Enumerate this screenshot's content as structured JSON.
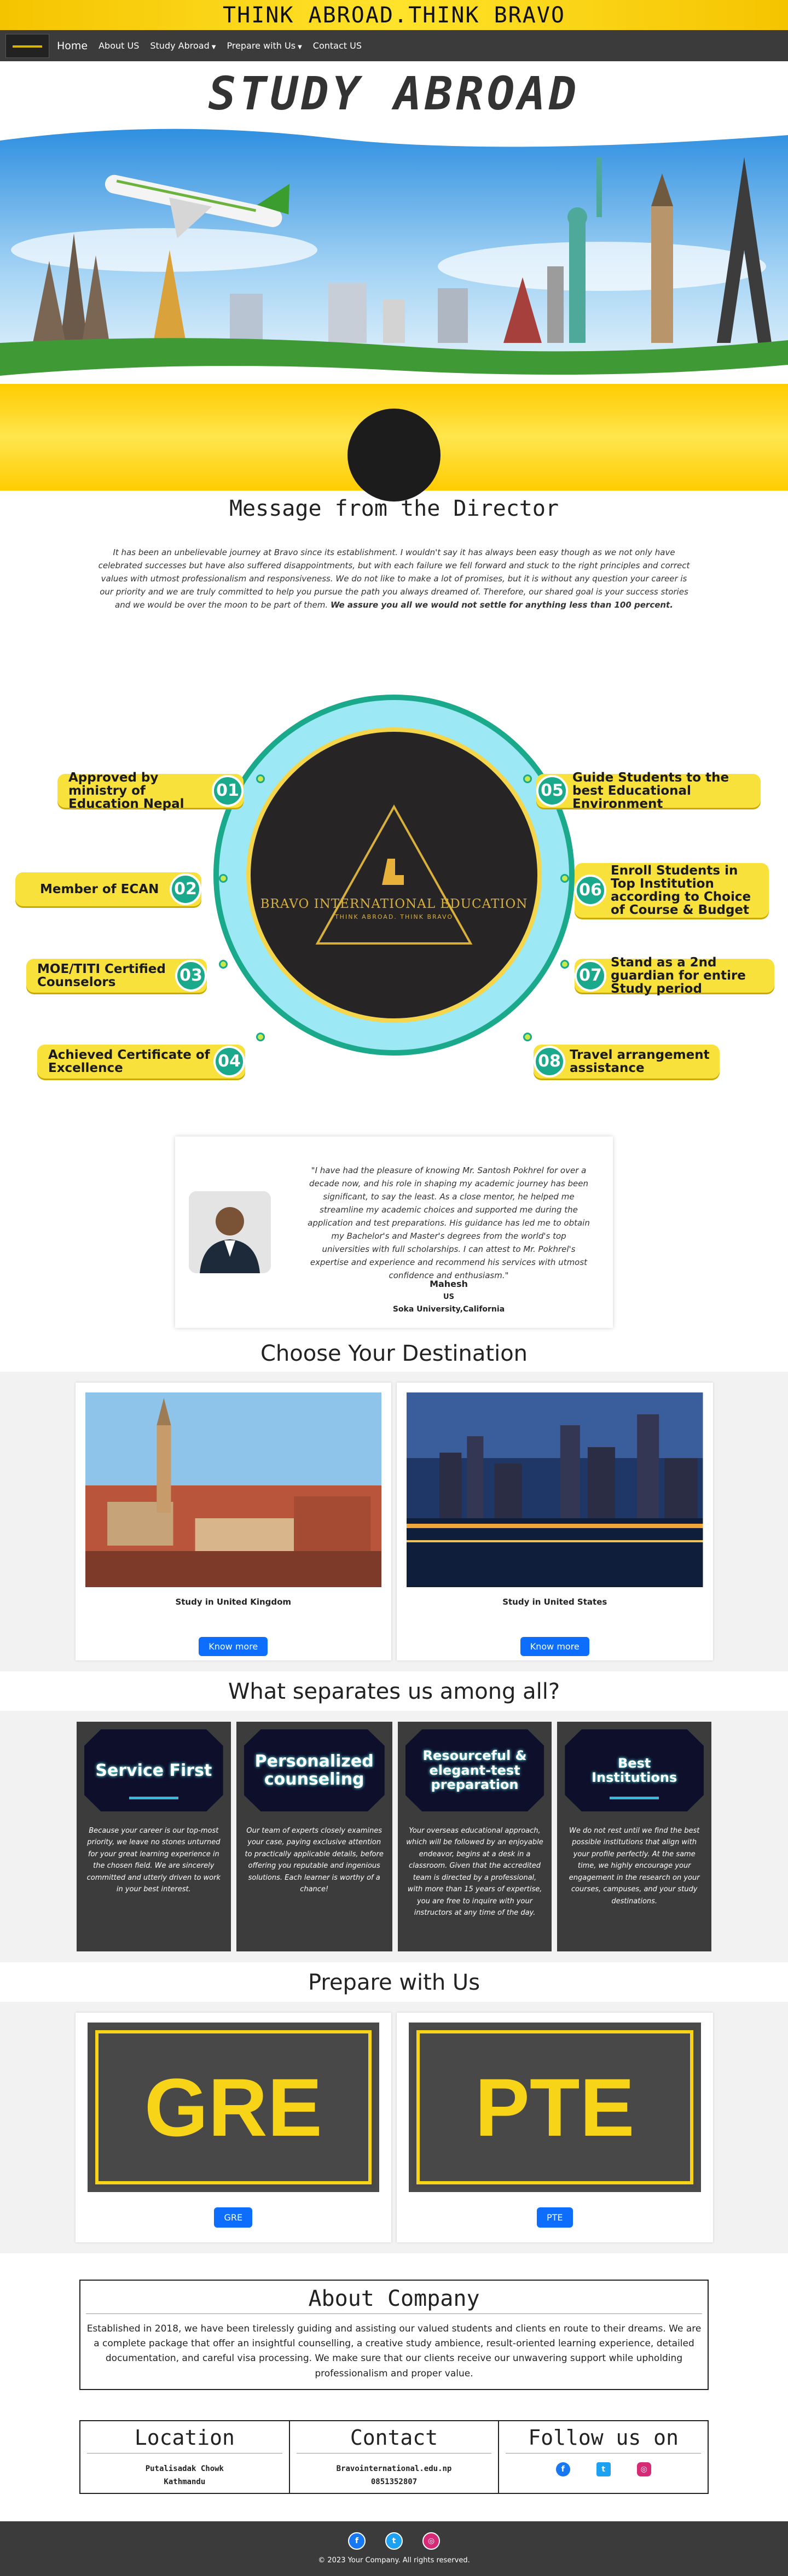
{
  "banner": {
    "tagline": "THINK ABROAD.THINK BRAVO"
  },
  "nav": {
    "home": "Home",
    "about": "About US",
    "study_abroad": "Study Abroad",
    "prepare": "Prepare with Us",
    "contact": "Contact US"
  },
  "hero": {
    "title": "STUDY ABROAD"
  },
  "director": {
    "title": "Message from the Director",
    "message": "It has been an unbelievable journey at Bravo since its establishment. I wouldn't say it has always been easy though as we not only have celebrated successes but have also suffered disappointments, but with each failure we fell forward and stuck to the right principles and correct values with utmost professionalism and responsiveness. We do not like to make a lot of promises, but it is without any question your career is our priority and we are truly committed to help you pursue the path you always dreamed of. Therefore, our shared goal is your success stories and we would be over the moon to be part of them.",
    "assurance": "We assure you all we would not settle for anything less than 100 percent."
  },
  "wheel": {
    "brand_name": "BRAVO INTERNATIONAL EDUCATION",
    "brand_tagline": "THINK ABROAD. THINK BRAVO",
    "items": [
      {
        "num": "01",
        "text": "Approved by ministry of Education Nepal"
      },
      {
        "num": "02",
        "text": "Member of ECAN"
      },
      {
        "num": "03",
        "text": "MOE/TITI Certified Counselors"
      },
      {
        "num": "04",
        "text": "Achieved Certificate of Excellence"
      },
      {
        "num": "05",
        "text": "Guide Students to the best Educational Environment"
      },
      {
        "num": "06",
        "text": "Enroll Students in Top Institution according to Choice of Course & Budget"
      },
      {
        "num": "07",
        "text": "Stand as a 2nd guardian for entire Study period"
      },
      {
        "num": "08",
        "text": "Travel arrangement assistance"
      }
    ]
  },
  "testimonial": {
    "quote": "\"I have had the pleasure of knowing Mr. Santosh Pokhrel for over a decade now, and his role in shaping my academic journey has been significant, to say the least. As a close mentor, he helped me streamline my academic choices and supported me during the application and test preparations. His guidance has led me to obtain my Bachelor's and Master's degrees from the world's top universities with full scholarships. I can attest to Mr. Pokhrel's expertise and experience and recommend his services with utmost confidence and enthusiasm.\"",
    "name": "Mahesh",
    "country": "US",
    "university": "Soka University,California"
  },
  "destinations": {
    "title": "Choose Your Destination",
    "cards": [
      {
        "label": "Study in United Kingdom",
        "button": "Know more"
      },
      {
        "label": "Study in United States",
        "button": "Know more"
      }
    ]
  },
  "separates": {
    "title": "What separates us among all?",
    "cards": [
      {
        "heading": "Service First",
        "text": "Because your career is our top-most priority, we leave no stones unturned for your great learning experience in the chosen field. We are sincerely committed and utterly driven to work in your best interest."
      },
      {
        "heading": "Personalized counseling",
        "text": "Our team of experts closely examines your case, paying exclusive attention to practically applicable details, before offering you reputable and ingenious solutions. Each learner is worthy of a chance!"
      },
      {
        "heading": "Resourceful & elegant-test preparation",
        "text": "Your overseas educational approach, which will be followed by an enjoyable endeavor, begins at a desk in a classroom. Given that the accredited team is directed by a professional, with more than 15 years of expertise, you are free to inquire with your instructors at any time of the day."
      },
      {
        "heading": "Best Institutions",
        "text": "We do not rest until we find the best possible institutions that align with your profile perfectly. At the same time, we highly encourage your engagement in the research on your courses, campuses, and your study destinations."
      }
    ]
  },
  "prepare": {
    "title": "Prepare with Us",
    "cards": [
      {
        "logo": "GRE",
        "button": "GRE"
      },
      {
        "logo": "PTE",
        "button": "PTE"
      }
    ]
  },
  "about": {
    "title": "About Company",
    "text": "Established in 2018, we have been tirelessly guiding and assisting our valued students and clients en route to their dreams. We are a complete package that offer an insightful counselling, a creative study ambience, result-oriented learning experience, detailed documentation, and careful visa processing. We make sure that our clients receive our unwavering support while upholding professionalism and proper value."
  },
  "info": {
    "location_title": "Location",
    "location_line1": "Putalisadak Chowk",
    "location_line2": "Kathmandu",
    "contact_title": "Contact",
    "contact_email": "Bravointernational.edu.np",
    "contact_phone": "0851352807",
    "follow_title": "Follow us on"
  },
  "footer": {
    "copyright": "© 2023 Your Company. All rights reserved."
  },
  "icons": {
    "facebook": "facebook-icon",
    "twitter": "twitter-icon",
    "instagram": "instagram-icon"
  },
  "colors": {
    "brand_yellow": "#f8e13a",
    "accent_teal": "#1aa98a",
    "nav_dark": "#3b3b3b",
    "button_blue": "#0d6efd"
  }
}
